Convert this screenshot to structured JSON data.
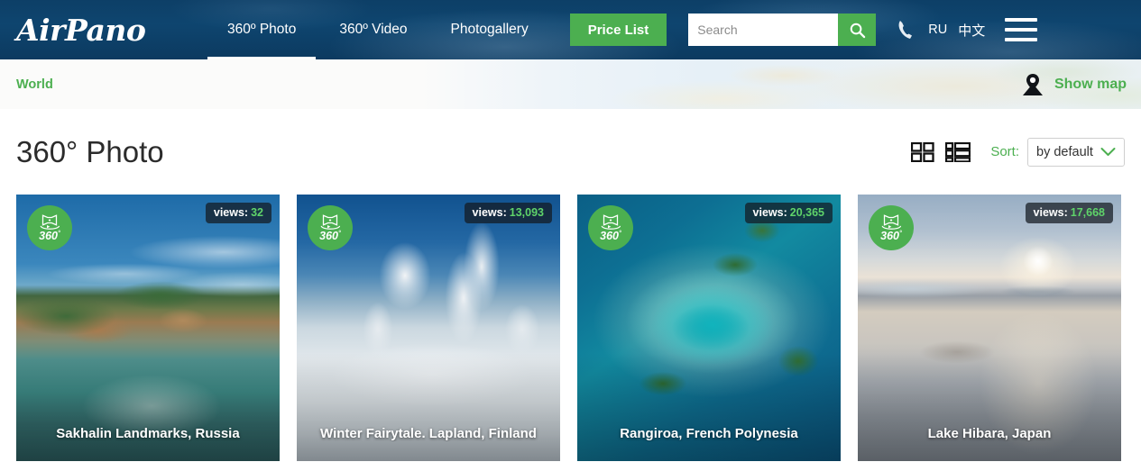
{
  "header": {
    "logo": "AirPano",
    "nav": [
      {
        "label": "360º Photo",
        "active": true
      },
      {
        "label": "360º Video",
        "active": false
      },
      {
        "label": "Photogallery",
        "active": false
      }
    ],
    "price_button": "Price List",
    "search": {
      "placeholder": "Search",
      "value": ""
    },
    "search_icon": "search-icon",
    "phone_icon": "phone-icon",
    "languages": [
      "RU",
      "中文"
    ],
    "menu_icon": "hamburger-menu-icon",
    "accent_green": "#4caf50",
    "background_blue": "#0d3f67"
  },
  "mapbar": {
    "breadcrumb": "World",
    "show_map_label": "Show map",
    "map_pin_icon": "map-pin-icon"
  },
  "page": {
    "title": "360° Photo",
    "view_grid_icon": "grid-view-icon",
    "view_list_icon": "list-view-icon",
    "sort_label": "Sort:",
    "sort_value": "by default",
    "sort_chevron_icon": "chevron-down-icon"
  },
  "cards": [
    {
      "title": "Sakhalin Landmarks, Russia",
      "views_label": "views:",
      "views": "32",
      "badge": "360",
      "badge_degree": "°",
      "badge_icon": "panorama-360-icon"
    },
    {
      "title": "Winter Fairytale. Lapland, Finland",
      "views_label": "views:",
      "views": "13,093",
      "badge": "360",
      "badge_degree": "°",
      "badge_icon": "panorama-360-icon"
    },
    {
      "title": "Rangiroa, French Polynesia",
      "views_label": "views:",
      "views": "20,365",
      "badge": "360",
      "badge_degree": "°",
      "badge_icon": "panorama-360-icon"
    },
    {
      "title": "Lake Hibara, Japan",
      "views_label": "views:",
      "views": "17,668",
      "badge": "360",
      "badge_degree": "°",
      "badge_icon": "panorama-360-icon"
    }
  ]
}
